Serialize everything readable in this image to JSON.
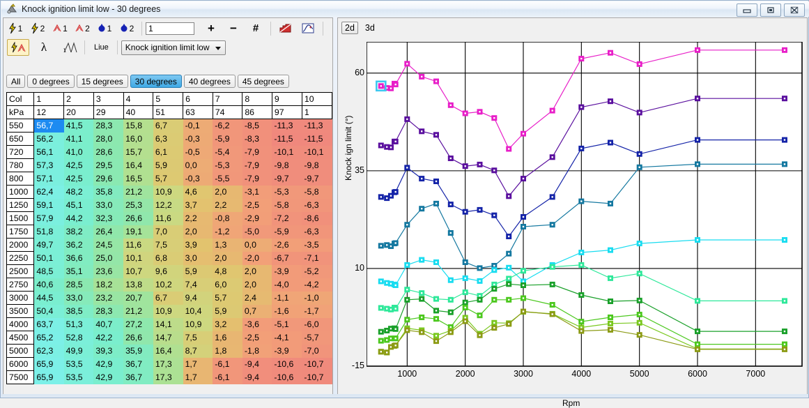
{
  "window": {
    "title": "Knock ignition limit low - 30 degrees",
    "icon": "app-icon",
    "buttons": [
      {
        "name": "minimize-button",
        "glyph": "minimize"
      },
      {
        "name": "maximize-button",
        "glyph": "maximize"
      },
      {
        "name": "close-button",
        "glyph": "close"
      }
    ]
  },
  "toolbar_top": {
    "icons": [
      {
        "name": "knock-sensor-1-icon",
        "label": "1",
        "kind": "bolt"
      },
      {
        "name": "knock-sensor-2-icon",
        "label": "2",
        "kind": "bolt"
      },
      {
        "name": "ignition-trace-1-icon",
        "label": "1",
        "kind": "spark"
      },
      {
        "name": "ignition-trace-2-icon",
        "label": "2",
        "kind": "spark"
      },
      {
        "name": "injector-1-icon",
        "label": "1",
        "kind": "drop"
      },
      {
        "name": "injector-2-icon",
        "label": "2",
        "kind": "drop"
      }
    ],
    "value_input": {
      "value": "1",
      "placeholder": ""
    },
    "plus_label": "+",
    "minus_label": "−",
    "hash_label": "#",
    "chart_icon": "bar-chart-icon",
    "curve_icon": "curve-chart-icon"
  },
  "toolbar_second": {
    "knock_mode_icon": "knock-ignition-icon",
    "lambda_icon": "lambda-icon",
    "lambda_delta_icon": "lambda-delta-icon",
    "live_label": "Liue",
    "map_select": {
      "value": "Knock ignition limit low",
      "options": [
        "Knock ignition limit low"
      ]
    }
  },
  "degree_tabs": [
    {
      "label": "All",
      "selected": false
    },
    {
      "label": "0 degrees",
      "selected": false
    },
    {
      "label": "15 degrees",
      "selected": false
    },
    {
      "label": "30 degrees",
      "selected": true
    },
    {
      "label": "40 degrees",
      "selected": false
    },
    {
      "label": "45 degrees",
      "selected": false
    }
  ],
  "grid": {
    "corner_col_label": "Col",
    "corner_unit_label": "kPa",
    "col_indices": [
      "1",
      "2",
      "3",
      "4",
      "5",
      "6",
      "7",
      "8",
      "9",
      "10"
    ],
    "col_kpa": [
      "12",
      "20",
      "29",
      "40",
      "51",
      "63",
      "74",
      "86",
      "97",
      "1"
    ],
    "row_labels": [
      "550",
      "650",
      "720",
      "780",
      "800",
      "1000",
      "1250",
      "1500",
      "1750",
      "2000",
      "2250",
      "2500",
      "2750",
      "3000",
      "3500",
      "4000",
      "4500",
      "5000",
      "6000",
      "7500"
    ],
    "selected_cell": {
      "row": 0,
      "col": 0
    },
    "rows": [
      [
        "56,7",
        "41,5",
        "28,3",
        "15,8",
        "6,7",
        "-0,1",
        "-6,2",
        "-8,5",
        "-11,3",
        "-11,3"
      ],
      [
        "56,2",
        "41,1",
        "28,0",
        "16,0",
        "6,3",
        "-0,3",
        "-5,9",
        "-8,3",
        "-11,5",
        "-11,5"
      ],
      [
        "56,1",
        "41,0",
        "28,6",
        "15,7",
        "6,1",
        "-0,5",
        "-5,4",
        "-7,9",
        "-10,1",
        "-10,1"
      ],
      [
        "57,3",
        "42,5",
        "29,5",
        "16,4",
        "5,9",
        "0,0",
        "-5,3",
        "-7,9",
        "-9,8",
        "-9,8"
      ],
      [
        "57,1",
        "42,5",
        "29,6",
        "16,5",
        "5,7",
        "-0,3",
        "-5,5",
        "-7,9",
        "-9,7",
        "-9,7"
      ],
      [
        "62,4",
        "48,2",
        "35,8",
        "21,2",
        "10,9",
        "4,6",
        "2,0",
        "-3,1",
        "-5,3",
        "-5,8"
      ],
      [
        "59,1",
        "45,1",
        "33,0",
        "25,3",
        "12,2",
        "3,7",
        "2,2",
        "-2,5",
        "-5,8",
        "-6,3"
      ],
      [
        "57,9",
        "44,2",
        "32,3",
        "26,6",
        "11,6",
        "2,2",
        "-0,8",
        "-2,9",
        "-7,2",
        "-8,6"
      ],
      [
        "51,8",
        "38,2",
        "26,4",
        "19,1",
        "7,0",
        "2,0",
        "-1,2",
        "-5,0",
        "-5,9",
        "-6,3"
      ],
      [
        "49,7",
        "36,2",
        "24,5",
        "11,6",
        "7,5",
        "3,9",
        "1,3",
        "0,0",
        "-2,6",
        "-3,5"
      ],
      [
        "50,1",
        "36,6",
        "25,0",
        "10,1",
        "6,8",
        "3,0",
        "2,0",
        "-2,0",
        "-6,7",
        "-7,1"
      ],
      [
        "48,5",
        "35,1",
        "23,6",
        "10,7",
        "9,6",
        "5,9",
        "4,8",
        "2,0",
        "-3,9",
        "-5,2"
      ],
      [
        "40,6",
        "28,5",
        "18,2",
        "13,8",
        "10,2",
        "7,4",
        "6,0",
        "2,0",
        "-4,0",
        "-4,2"
      ],
      [
        "44,5",
        "33,0",
        "23,2",
        "20,7",
        "6,7",
        "9,4",
        "5,7",
        "2,4",
        "-1,1",
        "-1,0"
      ],
      [
        "50,4",
        "38,5",
        "28,3",
        "21,2",
        "10,9",
        "10,4",
        "5,9",
        "0,7",
        "-1,6",
        "-1,7"
      ],
      [
        "63,7",
        "51,3",
        "40,7",
        "27,2",
        "14,1",
        "10,9",
        "3,2",
        "-3,6",
        "-5,1",
        "-6,0"
      ],
      [
        "65,2",
        "52,8",
        "42,2",
        "26,6",
        "14,7",
        "7,5",
        "1,6",
        "-2,5",
        "-4,1",
        "-5,7"
      ],
      [
        "62,3",
        "49,9",
        "39,3",
        "35,9",
        "16,4",
        "8,7",
        "1,8",
        "-1,8",
        "-3,9",
        "-7,0"
      ],
      [
        "65,9",
        "53,5",
        "42,9",
        "36,7",
        "17,3",
        "1,7",
        "-6,1",
        "-9,4",
        "-10,6",
        "-10,7"
      ],
      [
        "65,9",
        "53,5",
        "42,9",
        "36,7",
        "17,3",
        "1,7",
        "-6,1",
        "-9,4",
        "-10,6",
        "-10,7"
      ]
    ]
  },
  "view_tabs": [
    {
      "label": "2d",
      "active": true
    },
    {
      "label": "3d",
      "active": false
    }
  ],
  "chart_data": {
    "type": "line",
    "title": "",
    "xlabel": "Rpm",
    "ylabel": "Knock ign limit (°)",
    "xlim": [
      300,
      7800
    ],
    "ylim": [
      -15,
      68
    ],
    "yticks": [
      60,
      35,
      10,
      -15
    ],
    "xticks": [
      1000,
      2000,
      3000,
      4000,
      5000,
      6000,
      7000
    ],
    "grid": true,
    "legend": "none",
    "markers": "square",
    "selected_point": {
      "x": 550,
      "y": 56.7,
      "series": "12 kPa"
    },
    "x": [
      550,
      650,
      720,
      780,
      800,
      1000,
      1250,
      1500,
      1750,
      2000,
      2250,
      2500,
      2750,
      3000,
      3500,
      4000,
      4500,
      5000,
      6000,
      7500
    ],
    "series": [
      {
        "name": "12 kPa",
        "color": "#e81ec8",
        "values": [
          56.7,
          56.2,
          56.1,
          57.3,
          57.1,
          62.4,
          59.1,
          57.9,
          51.8,
          49.7,
          50.1,
          48.5,
          40.6,
          44.5,
          50.4,
          63.7,
          65.2,
          62.3,
          65.9,
          65.9
        ]
      },
      {
        "name": "20 kPa",
        "color": "#5a0f9e",
        "values": [
          41.5,
          41.1,
          41.0,
          42.5,
          42.5,
          48.2,
          45.1,
          44.2,
          38.2,
          36.2,
          36.6,
          35.1,
          28.5,
          33.0,
          38.5,
          51.3,
          52.8,
          49.9,
          53.5,
          53.5
        ]
      },
      {
        "name": "29 kPa",
        "color": "#1423a8",
        "values": [
          28.3,
          28.0,
          28.6,
          29.5,
          29.6,
          35.8,
          33.0,
          32.3,
          26.4,
          24.5,
          25.0,
          23.6,
          18.2,
          23.2,
          28.3,
          40.7,
          42.2,
          39.3,
          42.9,
          42.9
        ]
      },
      {
        "name": "40 kPa",
        "color": "#1478a0",
        "values": [
          15.8,
          16.0,
          15.7,
          16.4,
          16.5,
          21.2,
          25.3,
          26.6,
          19.1,
          11.6,
          10.1,
          10.7,
          13.8,
          20.7,
          21.2,
          27.2,
          26.6,
          35.9,
          36.7,
          36.7
        ]
      },
      {
        "name": "51 kPa",
        "color": "#18dcf0",
        "values": [
          6.7,
          6.3,
          6.1,
          5.9,
          5.7,
          10.9,
          12.2,
          11.6,
          7.0,
          7.5,
          6.8,
          9.6,
          10.2,
          6.7,
          10.9,
          14.1,
          14.7,
          16.4,
          17.3,
          17.3
        ]
      },
      {
        "name": "63 kPa",
        "color": "#2ee89a",
        "values": [
          -0.1,
          -0.3,
          -0.5,
          0.0,
          -0.3,
          4.6,
          3.7,
          2.2,
          2.0,
          3.9,
          3.0,
          5.9,
          7.4,
          9.4,
          10.4,
          10.9,
          7.5,
          8.7,
          1.7,
          1.7
        ]
      },
      {
        "name": "74 kPa",
        "color": "#1aa02a",
        "values": [
          -6.2,
          -5.9,
          -5.4,
          -5.3,
          -5.5,
          2.0,
          2.2,
          -0.8,
          -1.2,
          1.3,
          2.0,
          4.8,
          6.0,
          5.7,
          5.9,
          3.2,
          1.6,
          1.8,
          -6.1,
          -6.1
        ]
      },
      {
        "name": "86 kPa",
        "color": "#4cc81e",
        "values": [
          -8.5,
          -8.3,
          -7.9,
          -7.9,
          -7.9,
          -3.1,
          -2.5,
          -2.9,
          -5.0,
          0.0,
          -2.0,
          2.0,
          2.0,
          2.4,
          0.7,
          -3.6,
          -2.5,
          -1.8,
          -9.4,
          -9.4
        ]
      },
      {
        "name": "97 kPa",
        "color": "#7ac81e",
        "values": [
          -11.3,
          -11.5,
          -10.1,
          -9.8,
          -9.7,
          -5.3,
          -5.8,
          -7.2,
          -5.9,
          -2.6,
          -6.7,
          -3.9,
          -4.0,
          -1.1,
          -1.6,
          -5.1,
          -4.1,
          -3.9,
          -10.6,
          -10.6
        ]
      },
      {
        "name": "1 kPa",
        "color": "#8c9b14",
        "values": [
          -11.3,
          -11.5,
          -10.1,
          -9.8,
          -9.7,
          -5.8,
          -6.3,
          -8.6,
          -6.3,
          -3.5,
          -7.1,
          -5.2,
          -4.2,
          -1.0,
          -1.7,
          -6.0,
          -5.7,
          -7.0,
          -10.7,
          -10.7
        ]
      }
    ]
  },
  "cell_colors": {
    "high": "#7ff0e0",
    "mid": "#a8e8b0",
    "low": "#f08f80"
  }
}
